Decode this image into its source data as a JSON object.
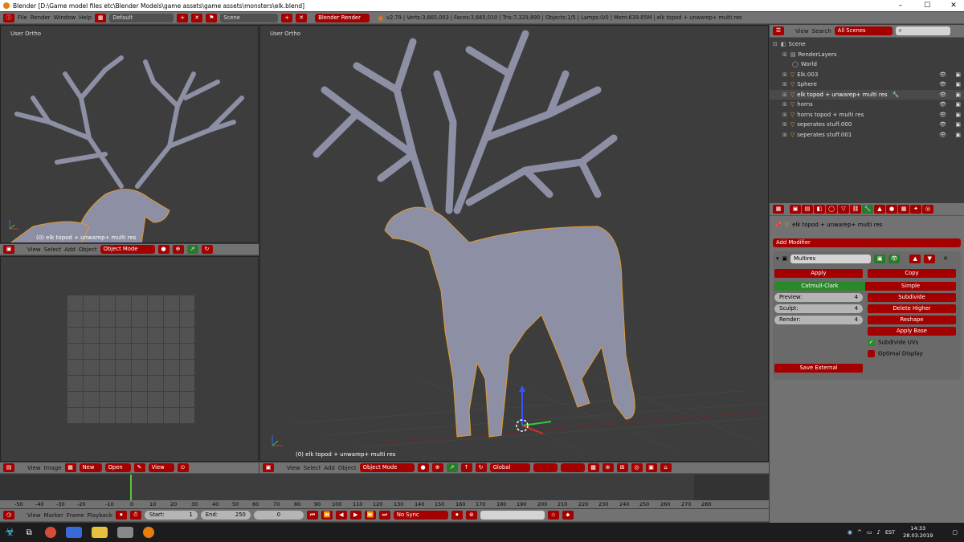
{
  "window": {
    "title": "Blender [D:\\Game model files etc\\Blender Models\\game assets\\game assets\\monsters\\elk.blend]",
    "min": "–",
    "max": "☐",
    "close": "✕"
  },
  "infobar": {
    "menus": [
      "File",
      "Render",
      "Window",
      "Help"
    ],
    "layout": "Default",
    "scene": "Scene",
    "engine": "Blender Render",
    "stats": "v2.79 | Verts:3,665,003 | Faces:3,665,010 | Tris:7,329,890 | Objects:1/5 | Lamps:0/0 | Mem:639.85M | elk topod + unwarep+ multi res"
  },
  "vp_left": {
    "label": "User Ortho",
    "object": "(0) elk topod + unwarep+ multi res",
    "menus": [
      "View",
      "Select",
      "Add",
      "Object"
    ],
    "mode": "Object Mode"
  },
  "vp_main": {
    "label": "User Ortho",
    "object": "(0) elk topod + unwarep+ multi res",
    "menus": [
      "View",
      "Select",
      "Add",
      "Object"
    ],
    "mode": "Object Mode",
    "orientation": "Global"
  },
  "uv_editor": {
    "menus": [
      "View",
      "Image"
    ],
    "new_label": "New",
    "open_label": "Open",
    "view_label": "View"
  },
  "outliner": {
    "menus": [
      "View",
      "Search"
    ],
    "filter": "All Scenes",
    "items": [
      {
        "label": "Scene"
      },
      {
        "label": "RenderLayers"
      },
      {
        "label": "World"
      },
      {
        "label": "Elk.003"
      },
      {
        "label": "Sphere"
      },
      {
        "label": "elk topod + unwarep+ multi res"
      },
      {
        "label": "horns"
      },
      {
        "label": "horns topod + multi res"
      },
      {
        "label": "seperates stuff.000"
      },
      {
        "label": "seperates stuff.001"
      }
    ]
  },
  "properties": {
    "breadcrumb": "elk topod + unwarep+ multi res",
    "add_modifier": "Add Modifier",
    "modifier_name": "Multires",
    "apply": "Apply",
    "copy": "Copy",
    "catmull": "Catmull-Clark",
    "simple": "Simple",
    "preview_label": "Preview:",
    "preview_val": "4",
    "sculpt_label": "Sculpt:",
    "sculpt_val": "4",
    "render_label": "Render:",
    "render_val": "4",
    "subdivide": "Subdivide",
    "delete_higher": "Delete Higher",
    "reshape": "Reshape",
    "apply_base": "Apply Base",
    "subdivide_uvs": "Subdivide UVs",
    "optimal_display": "Optimal Display",
    "save_external": "Save External"
  },
  "timeline": {
    "ticks": [
      "-50",
      "-40",
      "-30",
      "-20",
      "-10",
      "0",
      "10",
      "20",
      "30",
      "40",
      "50",
      "60",
      "70",
      "80",
      "90",
      "100",
      "110",
      "120",
      "130",
      "140",
      "150",
      "160",
      "170",
      "180",
      "190",
      "200",
      "210",
      "220",
      "230",
      "240",
      "250",
      "260",
      "270",
      "280"
    ],
    "menus": [
      "View",
      "Marker",
      "Frame",
      "Playback"
    ],
    "start_label": "Start:",
    "start_val": "1",
    "end_label": "End:",
    "end_val": "250",
    "current": "0",
    "sync": "No Sync"
  },
  "taskbar": {
    "lang": "EST",
    "time": "14:33",
    "date": "28.03.2019"
  }
}
